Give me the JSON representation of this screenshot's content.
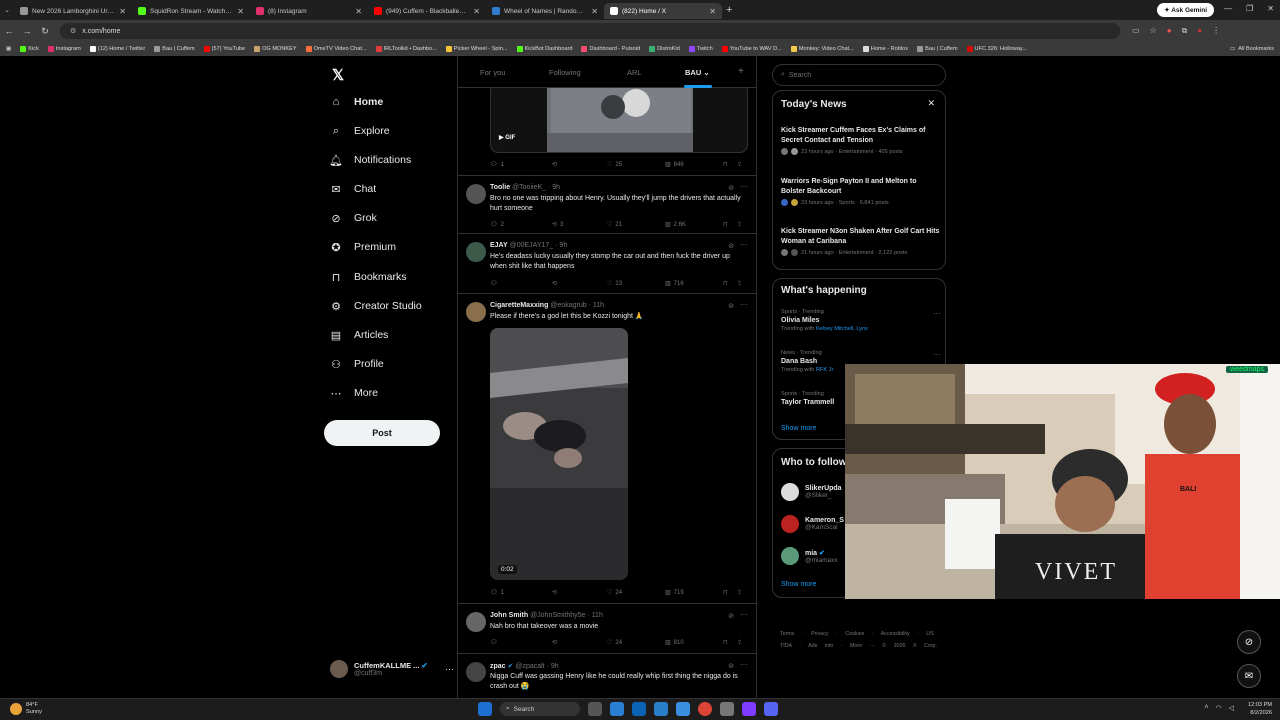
{
  "browser": {
    "tabs": [
      {
        "title": "New 2026 Lamborghini Urus SE",
        "color": "#999999"
      },
      {
        "title": "SquidRon Stream - Watch Live",
        "color": "#53fc18"
      },
      {
        "title": "(8) Instagram",
        "color": "#e1306c"
      },
      {
        "title": "(949) Cuffem - Blackballed (Sh",
        "color": "#ff0000"
      },
      {
        "title": "Wheel of Names | Random nam",
        "color": "#2e7bcf"
      },
      {
        "title": "(822) Home / X",
        "color": "#ffffff"
      }
    ],
    "gemini": "Ask Gemini",
    "url": "x.com/home",
    "bookmarks": [
      {
        "label": "Kick",
        "color": "#53fc18"
      },
      {
        "label": "Instagram",
        "color": "#e1306c"
      },
      {
        "label": "(12) Home / Twitter",
        "color": "#ffffff"
      },
      {
        "label": "Bau | Cuffem",
        "color": "#999999"
      },
      {
        "label": "(57) YouTube",
        "color": "#ff0000"
      },
      {
        "label": "OG MONKEY",
        "color": "#c9a26b"
      },
      {
        "label": "OmeTV Video Chat...",
        "color": "#ff6f3c"
      },
      {
        "label": "IRLToolkit • Dashbo...",
        "color": "#e23b3b"
      },
      {
        "label": "Picker Wheel - Spin...",
        "color": "#f6c33b"
      },
      {
        "label": "KickBot Dashboard",
        "color": "#53fc18"
      },
      {
        "label": "Dashboard - Pulsoid",
        "color": "#ff4d6d"
      },
      {
        "label": "DistroKid",
        "color": "#3bb273"
      },
      {
        "label": "Twitch",
        "color": "#9146ff"
      },
      {
        "label": "YouTube to WAV D...",
        "color": "#ff0000"
      },
      {
        "label": "Monkey: Video Chat...",
        "color": "#f2c94c"
      },
      {
        "label": "Home - Roblox",
        "color": "#dddddd"
      },
      {
        "label": "Bau | Cuffem",
        "color": "#999999"
      },
      {
        "label": "UFC 326: Holloway...",
        "color": "#d20a0a"
      }
    ],
    "all_bookmarks": "All Bookmarks"
  },
  "nav": {
    "items": [
      {
        "label": "Home",
        "icon": "home-icon"
      },
      {
        "label": "Explore",
        "icon": "search-icon"
      },
      {
        "label": "Notifications",
        "icon": "bell-icon"
      },
      {
        "label": "Chat",
        "icon": "chat-icon"
      },
      {
        "label": "Grok",
        "icon": "grok-icon"
      },
      {
        "label": "Premium",
        "icon": "premium-icon"
      },
      {
        "label": "Bookmarks",
        "icon": "bookmark-icon"
      },
      {
        "label": "Creator Studio",
        "icon": "creator-studio-icon"
      },
      {
        "label": "Articles",
        "icon": "articles-icon"
      },
      {
        "label": "Profile",
        "icon": "profile-icon"
      },
      {
        "label": "More",
        "icon": "more-icon"
      }
    ],
    "post_label": "Post",
    "account": {
      "name": "CuffemKALLME ...",
      "handle": "@cuff3m"
    }
  },
  "feed": {
    "tabs": [
      "For you",
      "Following",
      "ARL",
      "BAU"
    ],
    "active_tab": "BAU",
    "posts": [
      {
        "author": "",
        "handle": "",
        "time": "",
        "text": "",
        "media_label": "GIF",
        "reply": "1",
        "repost": "",
        "like": "25",
        "views": "846"
      },
      {
        "author": "Toolie",
        "handle": "@TooiieK_",
        "time": "9h",
        "text": "Bro no one was tripping about Henry. Usually they'll jump the drivers that actually hurt someone",
        "reply": "2",
        "repost": "3",
        "like": "21",
        "views": "2.6K"
      },
      {
        "author": "EJAY",
        "handle": "@00EJAY17_",
        "time": "9h",
        "text": "He's deadass lucky usually they stomp the car out and then fuck the driver up when shit like that happens",
        "reply": "",
        "repost": "",
        "like": "23",
        "views": "716"
      },
      {
        "author": "CigaretteMaxxing",
        "handle": "@eokagrub",
        "time": "11h",
        "text": "Please if there's a god let this be Kozzi tonight 🙏",
        "video_time": "0:02",
        "reply": "1",
        "repost": "",
        "like": "24",
        "views": "719"
      },
      {
        "author": "John Smith",
        "handle": "@JohnSmithhy5e",
        "time": "11h",
        "text": "Nah bro that takeover was a movie",
        "reply": "",
        "repost": "",
        "like": "24",
        "views": "810"
      },
      {
        "author": "zpac",
        "handle": "@zpacalt",
        "time": "9h",
        "text": "Nigga Cuff was gassing Henry like he could really whip first thing the nigga do is crash out 😭"
      }
    ]
  },
  "sidebar": {
    "search_placeholder": "Search",
    "todays_news": {
      "title": "Today's News",
      "items": [
        {
          "headline": "Kick Streamer Cuffem Faces Ex's Claims of Secret Contact and Tension",
          "meta": "23 hours ago · Entertainment · 405 posts"
        },
        {
          "headline": "Warriors Re-Sign Payton II and Melton to Bolster Backcourt",
          "meta": "23 hours ago · Sports · 6,841 posts"
        },
        {
          "headline": "Kick Streamer N3on Shaken After Golf Cart Hits Woman at Caribana",
          "meta": "21 hours ago · Entertainment · 2,122 posts"
        }
      ]
    },
    "whats_happening": {
      "title": "What's happening",
      "items": [
        {
          "category": "Sports · Trending",
          "name": "Olivia Miles",
          "sub_prefix": "Trending with",
          "sub_link": "Kelsey Mitchell, Lynx"
        },
        {
          "category": "News · Trending",
          "name": "Dana Bash",
          "sub_prefix": "Trending with",
          "sub_link": "RFK Jr"
        },
        {
          "category": "Sports · Trending",
          "name": "Taylor Trammell",
          "sub_prefix": "",
          "sub_link": ""
        }
      ],
      "show_more": "Show more"
    },
    "who_to_follow": {
      "title": "Who to follow",
      "items": [
        {
          "name": "SlikerUpda",
          "handle": "@Sliker_"
        },
        {
          "name": "Kameron_S",
          "handle": "@KamScal"
        },
        {
          "name": "mia",
          "handle": "@miamaxx"
        }
      ],
      "show_more": "Show more"
    },
    "footer": "Terms · Privacy · Cookies · Accessibility · US TIDA · Ads info · More ··· © 2026 X Corp."
  },
  "overlay": {
    "weedmaps": "weedmaps",
    "shirt": "VIVET",
    "shirt2": "BALI"
  },
  "taskbar": {
    "temp": "84°F",
    "weather": "Sunny",
    "search": "Search",
    "time": "12:03 PM",
    "date": "8/2/2026"
  }
}
